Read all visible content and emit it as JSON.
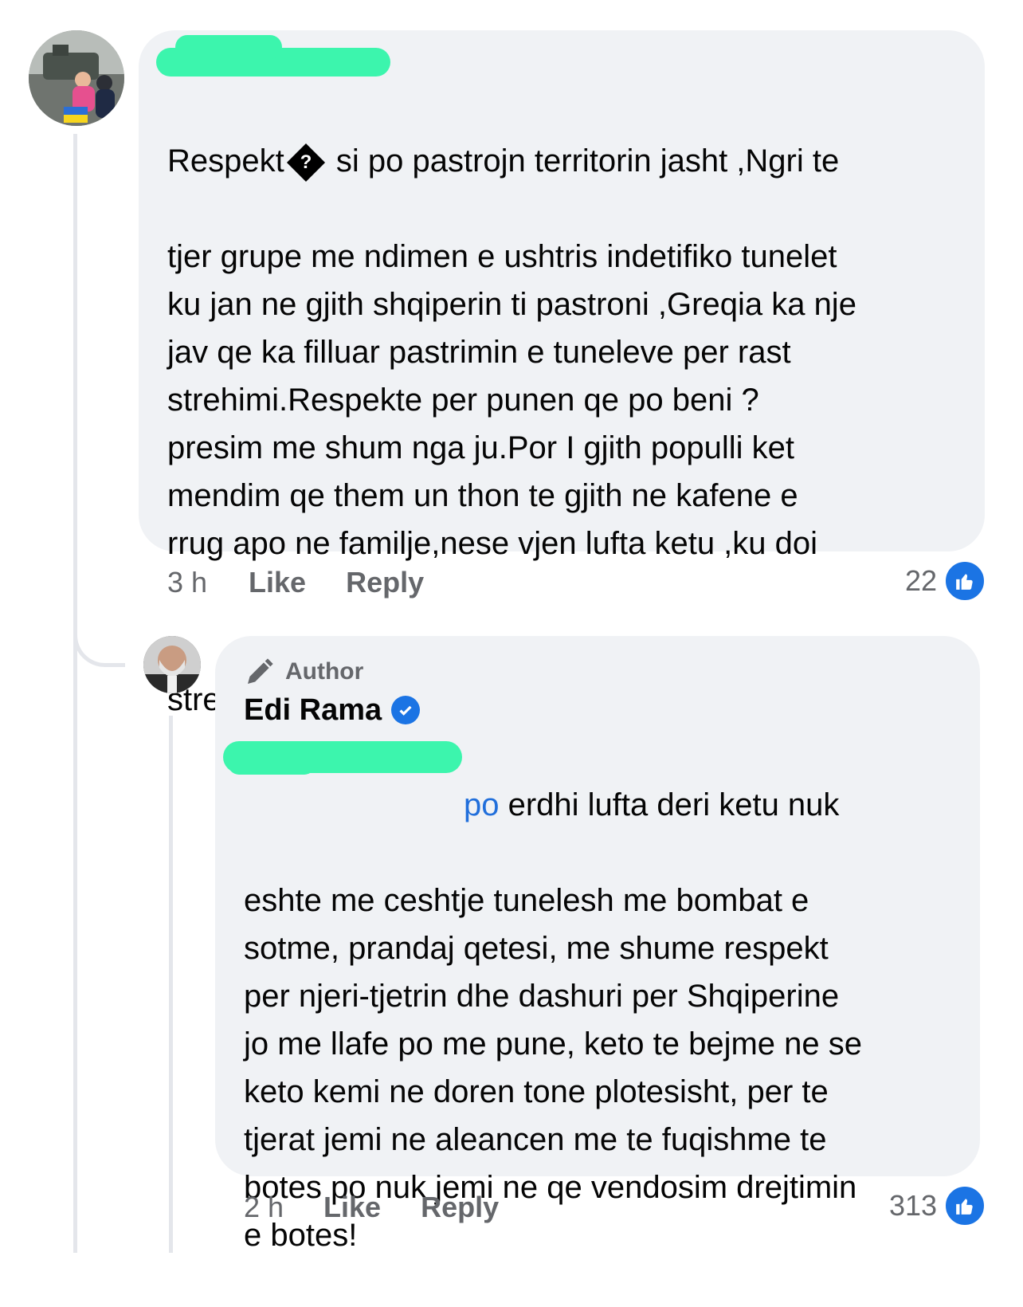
{
  "comment": {
    "text_line1_a": "Respekt",
    "text_glyph": "?",
    "text_line1_b": " si po pastrojn territorin jasht ,Ngri te",
    "text_rest": "tjer grupe me ndimen e ushtris indetifiko tunelet\nku jan ne gjith shqiperin ti pastroni ,Greqia ka nje\njav qe ka filluar pastrimin e tuneleve per rast\nstrehimi.Respekte  per punen qe po beni ?\npresim me shum nga ju.Por I gjith populli ket\nmendim qe them un thon te gjith ne kafene e\nrrug apo ne familje,nese vjen lufta ketu ,ku doi",
    "text_last": "strehojm feminjet.",
    "emojis": [
      "pray-emoji",
      "ukraine-flag-emoji",
      "heart-emoji",
      "albania-flag-emoji",
      "muscle-emoji",
      "muscle-emoji",
      "muscle-emoji"
    ],
    "emoji_glyphs": {
      "pray": "🙏",
      "heart": "❤",
      "muscle": "💪"
    },
    "time": "3 h",
    "like_label": "Like",
    "reply_label": "Reply",
    "reaction_count": "22"
  },
  "reply": {
    "author_tag": "Author",
    "author_name": "Edi Rama",
    "mention_visible": "po",
    "text_first": " erdhi lufta deri ketu nuk",
    "text_rest": "eshte me ceshtje tunelesh me bombat e\nsotme, prandaj qetesi, me shume respekt\nper njeri-tjetrin dhe dashuri per Shqiperine\njo me llafe po me pune, keto te bejme ne se\nketo kemi ne doren tone plotesisht, per te\ntjerat jemi ne aleancen me te fuqishme te\nbotes po nuk jemi ne qe vendosim drejtimin\ne botes!",
    "time": "2 h",
    "like_label": "Like",
    "reply_label": "Reply",
    "reaction_count": "313"
  },
  "colors": {
    "bubble": "#f0f2f5",
    "accent": "#1b74e4",
    "muted": "#65676b",
    "redaction": "#3cf5ad"
  }
}
